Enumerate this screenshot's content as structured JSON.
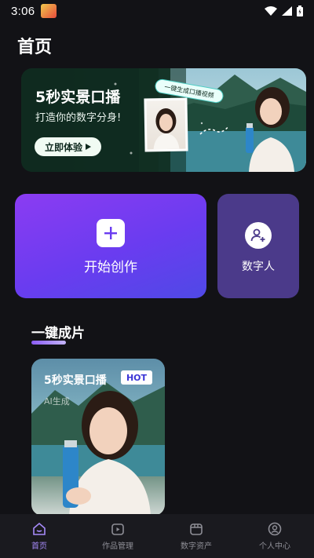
{
  "status_bar": {
    "time": "3:06"
  },
  "page_title": "首页",
  "banner": {
    "title": "5秒实景口播",
    "subtitle": "打造你的数字分身!",
    "cta_label": "立即体验",
    "bubble_text": "一键生成口播视频"
  },
  "actions": {
    "create_label": "开始创作",
    "digital_label": "数字人"
  },
  "section": {
    "title": "一键成片"
  },
  "template_card": {
    "title": "5秒实景口播",
    "badge": "HOT",
    "subtitle": "AI生成"
  },
  "bottom_nav": [
    {
      "label": "首页",
      "icon": "home-icon",
      "active": true
    },
    {
      "label": "作品管理",
      "icon": "video-icon",
      "active": false
    },
    {
      "label": "数字资产",
      "icon": "box-icon",
      "active": false
    },
    {
      "label": "个人中心",
      "icon": "user-icon",
      "active": false
    }
  ],
  "colors": {
    "background": "#121216",
    "accent_purple": "#8b3cf2",
    "active_nav": "#a78bfa",
    "hot_text": "#3b35d6"
  }
}
